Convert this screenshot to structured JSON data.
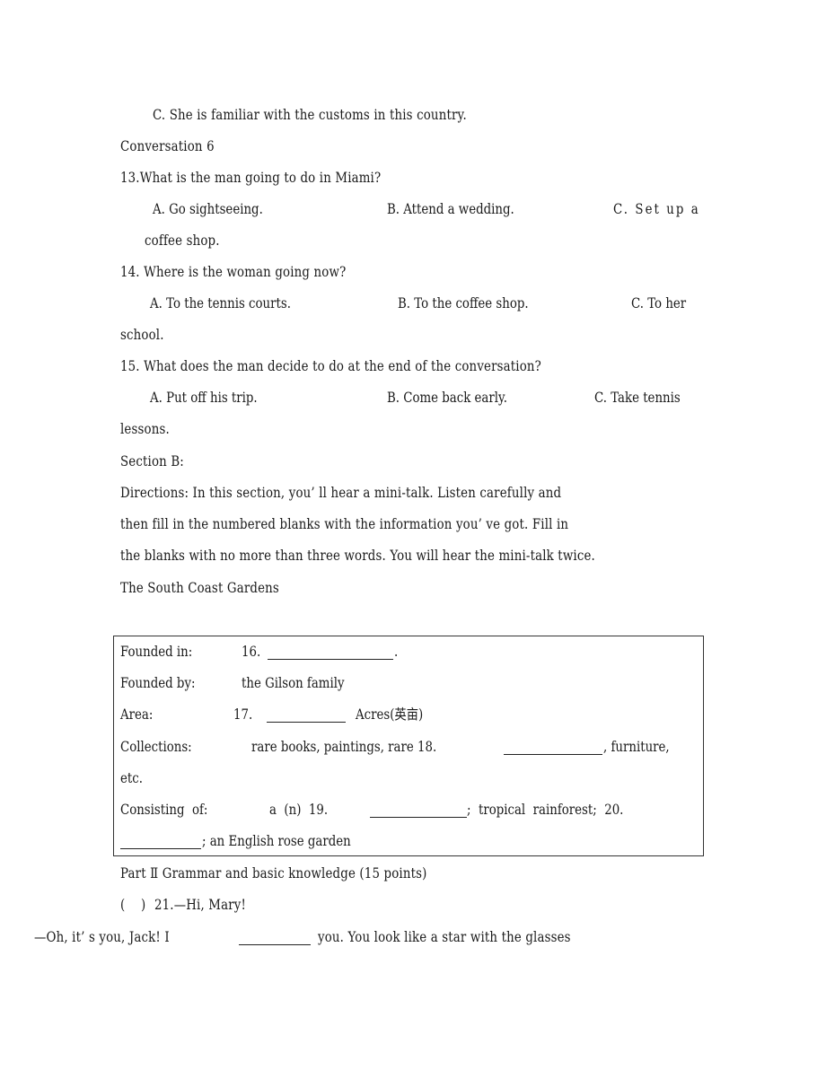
{
  "prev_question": {
    "option_c": "C. She is familiar with the customs in this country."
  },
  "conversation6": {
    "title": "Conversation 6",
    "questions": [
      {
        "number": "13.",
        "text": "13.What is the man going to do in Miami?",
        "options": [
          "A. Go sightseeing.",
          "B. Attend a wedding.",
          "C. Set up a"
        ],
        "wrap": "coffee shop."
      },
      {
        "number": "14.",
        "text": "14. Where is the woman going now?",
        "options": [
          "A. To the tennis courts.",
          "B. To the coffee shop.",
          "C. To her"
        ],
        "wrap": "school."
      },
      {
        "number": "15.",
        "text": "15. What does the man decide to do at the end of the conversation?",
        "options": [
          "A. Put off his trip.",
          "B. Come back early.",
          "C. Take tennis"
        ],
        "wrap": "lessons."
      }
    ]
  },
  "section_b": {
    "title": "Section B:",
    "directions": [
      "Directions: In this section, you’ ll hear a mini-talk. Listen carefully and",
      "then fill in the numbered blanks with the information you’ ve got. Fill in",
      "the blanks with no more than three words. You will hear the mini-talk twice."
    ],
    "talk_title": "The South Coast Gardens",
    "table": {
      "founded_in_label": "Founded in:",
      "founded_in_num": "16.",
      "founded_in_end": ".",
      "founded_by_label": "Founded by:",
      "founded_by_value": "the Gilson family",
      "area_label": "Area:",
      "area_num": "17.",
      "area_unit": "Acres(英亩)",
      "collections_label": "Collections:",
      "collections_pre": "rare books, paintings, rare 18.",
      "collections_post": ", furniture,",
      "collections_wrap": "etc.",
      "consisting_label": "Consisting  of:",
      "consisting_a": "a  (n)  19.",
      "consisting_mid": ";  tropical  rainforest;  20.",
      "consisting_end": "; an English rose garden"
    }
  },
  "part2": {
    "title": "Part Ⅱ Grammar and basic knowledge (15 points)",
    "q21_paren": "(    )",
    "q21_text": "21.—Hi, Mary!",
    "q21_reply_pre": "—Oh, it’ s you, Jack! I",
    "q21_reply_post": "you. You look like a star with the glasses"
  }
}
